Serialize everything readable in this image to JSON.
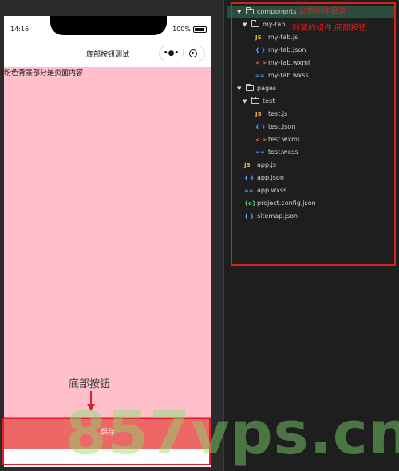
{
  "simulator": {
    "status_time": "14:16",
    "battery": "100%",
    "nav_title": "底部按钮测试",
    "page_text": "粉色背景部分是页面内容",
    "annotation_label": "底部按钮",
    "save_button": "保存"
  },
  "file_tree": {
    "components_folder": "components",
    "components_note": "公共组件目录",
    "my_tab_folder": "my-tab",
    "my_tab_note": "封装的组件,底部按钮",
    "my_tab_js": "my-tab.js",
    "my_tab_json": "my-tab.json",
    "my_tab_wxml": "my-tab.wxml",
    "my_tab_wxss": "my-tab.wxss",
    "pages_folder": "pages",
    "test_folder": "test",
    "test_js": "test.js",
    "test_json": "test.json",
    "test_wxml": "test.wxml",
    "test_wxss": "test.wxss",
    "app_js": "app.js",
    "app_json": "app.json",
    "app_wxss": "app.wxss",
    "project_config": "project.config.json",
    "sitemap_json": "sitemap.json"
  },
  "icons": {
    "js": "JS",
    "json": "{ }",
    "wxml": "< >",
    "wxss": "≈≈",
    "config": "{o}"
  },
  "colors": {
    "page_background": "#ffc0cb",
    "tab_bar": "#ee6767",
    "annotation_red": "#e02020",
    "selected_row": "#2a4d3c",
    "js_icon": "#e8b04a",
    "json_icon": "#4fa6ff",
    "wxml_icon": "#e06c3c",
    "wxss_icon": "#4f8cc9",
    "config_icon": "#5bbf7a"
  },
  "watermark": "857vps.cn"
}
